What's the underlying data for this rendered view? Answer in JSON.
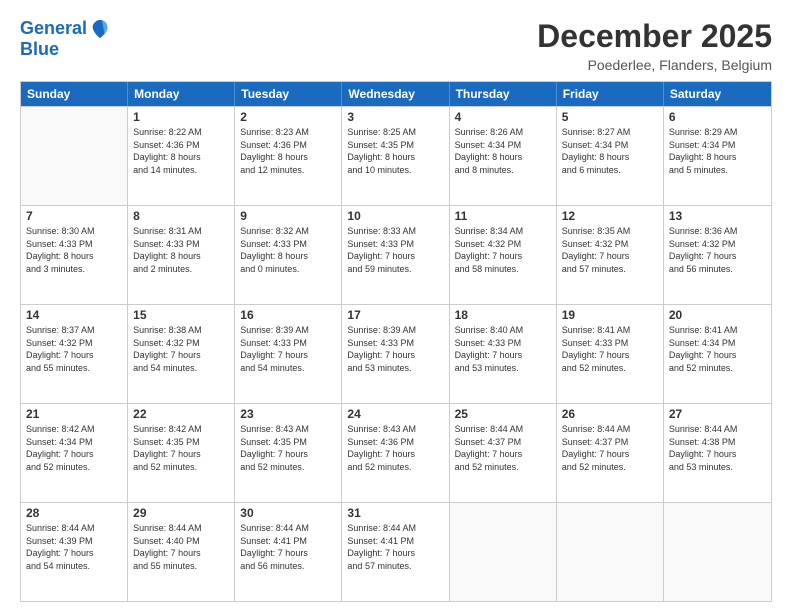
{
  "logo": {
    "line1": "General",
    "line2": "Blue"
  },
  "title": "December 2025",
  "subtitle": "Poederlee, Flanders, Belgium",
  "days": [
    "Sunday",
    "Monday",
    "Tuesday",
    "Wednesday",
    "Thursday",
    "Friday",
    "Saturday"
  ],
  "weeks": [
    [
      {
        "day": "",
        "info": ""
      },
      {
        "day": "1",
        "info": "Sunrise: 8:22 AM\nSunset: 4:36 PM\nDaylight: 8 hours\nand 14 minutes."
      },
      {
        "day": "2",
        "info": "Sunrise: 8:23 AM\nSunset: 4:36 PM\nDaylight: 8 hours\nand 12 minutes."
      },
      {
        "day": "3",
        "info": "Sunrise: 8:25 AM\nSunset: 4:35 PM\nDaylight: 8 hours\nand 10 minutes."
      },
      {
        "day": "4",
        "info": "Sunrise: 8:26 AM\nSunset: 4:34 PM\nDaylight: 8 hours\nand 8 minutes."
      },
      {
        "day": "5",
        "info": "Sunrise: 8:27 AM\nSunset: 4:34 PM\nDaylight: 8 hours\nand 6 minutes."
      },
      {
        "day": "6",
        "info": "Sunrise: 8:29 AM\nSunset: 4:34 PM\nDaylight: 8 hours\nand 5 minutes."
      }
    ],
    [
      {
        "day": "7",
        "info": "Sunrise: 8:30 AM\nSunset: 4:33 PM\nDaylight: 8 hours\nand 3 minutes."
      },
      {
        "day": "8",
        "info": "Sunrise: 8:31 AM\nSunset: 4:33 PM\nDaylight: 8 hours\nand 2 minutes."
      },
      {
        "day": "9",
        "info": "Sunrise: 8:32 AM\nSunset: 4:33 PM\nDaylight: 8 hours\nand 0 minutes."
      },
      {
        "day": "10",
        "info": "Sunrise: 8:33 AM\nSunset: 4:33 PM\nDaylight: 7 hours\nand 59 minutes."
      },
      {
        "day": "11",
        "info": "Sunrise: 8:34 AM\nSunset: 4:32 PM\nDaylight: 7 hours\nand 58 minutes."
      },
      {
        "day": "12",
        "info": "Sunrise: 8:35 AM\nSunset: 4:32 PM\nDaylight: 7 hours\nand 57 minutes."
      },
      {
        "day": "13",
        "info": "Sunrise: 8:36 AM\nSunset: 4:32 PM\nDaylight: 7 hours\nand 56 minutes."
      }
    ],
    [
      {
        "day": "14",
        "info": "Sunrise: 8:37 AM\nSunset: 4:32 PM\nDaylight: 7 hours\nand 55 minutes."
      },
      {
        "day": "15",
        "info": "Sunrise: 8:38 AM\nSunset: 4:32 PM\nDaylight: 7 hours\nand 54 minutes."
      },
      {
        "day": "16",
        "info": "Sunrise: 8:39 AM\nSunset: 4:33 PM\nDaylight: 7 hours\nand 54 minutes."
      },
      {
        "day": "17",
        "info": "Sunrise: 8:39 AM\nSunset: 4:33 PM\nDaylight: 7 hours\nand 53 minutes."
      },
      {
        "day": "18",
        "info": "Sunrise: 8:40 AM\nSunset: 4:33 PM\nDaylight: 7 hours\nand 53 minutes."
      },
      {
        "day": "19",
        "info": "Sunrise: 8:41 AM\nSunset: 4:33 PM\nDaylight: 7 hours\nand 52 minutes."
      },
      {
        "day": "20",
        "info": "Sunrise: 8:41 AM\nSunset: 4:34 PM\nDaylight: 7 hours\nand 52 minutes."
      }
    ],
    [
      {
        "day": "21",
        "info": "Sunrise: 8:42 AM\nSunset: 4:34 PM\nDaylight: 7 hours\nand 52 minutes."
      },
      {
        "day": "22",
        "info": "Sunrise: 8:42 AM\nSunset: 4:35 PM\nDaylight: 7 hours\nand 52 minutes."
      },
      {
        "day": "23",
        "info": "Sunrise: 8:43 AM\nSunset: 4:35 PM\nDaylight: 7 hours\nand 52 minutes."
      },
      {
        "day": "24",
        "info": "Sunrise: 8:43 AM\nSunset: 4:36 PM\nDaylight: 7 hours\nand 52 minutes."
      },
      {
        "day": "25",
        "info": "Sunrise: 8:44 AM\nSunset: 4:37 PM\nDaylight: 7 hours\nand 52 minutes."
      },
      {
        "day": "26",
        "info": "Sunrise: 8:44 AM\nSunset: 4:37 PM\nDaylight: 7 hours\nand 52 minutes."
      },
      {
        "day": "27",
        "info": "Sunrise: 8:44 AM\nSunset: 4:38 PM\nDaylight: 7 hours\nand 53 minutes."
      }
    ],
    [
      {
        "day": "28",
        "info": "Sunrise: 8:44 AM\nSunset: 4:39 PM\nDaylight: 7 hours\nand 54 minutes."
      },
      {
        "day": "29",
        "info": "Sunrise: 8:44 AM\nSunset: 4:40 PM\nDaylight: 7 hours\nand 55 minutes."
      },
      {
        "day": "30",
        "info": "Sunrise: 8:44 AM\nSunset: 4:41 PM\nDaylight: 7 hours\nand 56 minutes."
      },
      {
        "day": "31",
        "info": "Sunrise: 8:44 AM\nSunset: 4:41 PM\nDaylight: 7 hours\nand 57 minutes."
      },
      {
        "day": "",
        "info": ""
      },
      {
        "day": "",
        "info": ""
      },
      {
        "day": "",
        "info": ""
      }
    ]
  ]
}
